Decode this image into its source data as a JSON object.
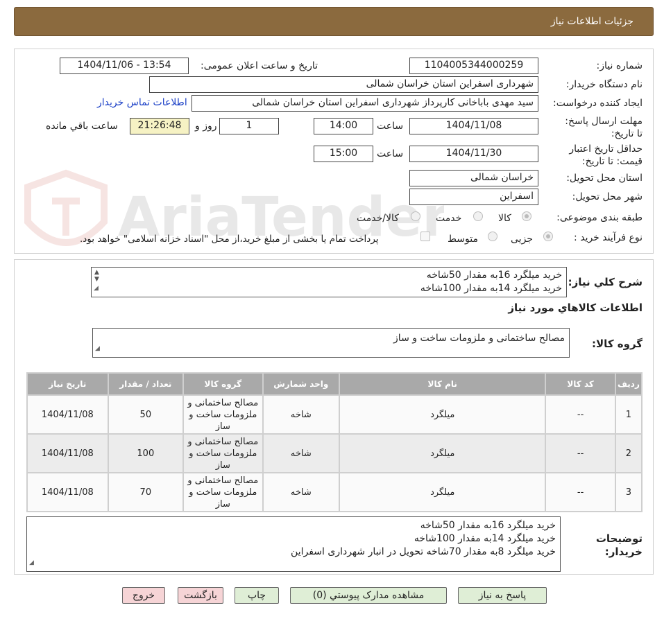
{
  "page_title": "جزئیات اطلاعات نیاز",
  "labels": {
    "need_number": "شماره نیاز:",
    "announce_datetime": "تاریخ و ساعت اعلان عمومی:",
    "buyer_org": "نام دستگاه خریدار:",
    "requester": "ایجاد کننده درخواست:",
    "reply_deadline": "مهلت ارسال پاسخ: تا تاریخ:",
    "hour": "ساعت",
    "day_and": "روز و",
    "remaining": "ساعت باقي مانده",
    "price_validity": "حداقل تاريخ اعتبار قیمت: تا تاریخ:",
    "province": "استان محل تحویل:",
    "city": "شهر محل تحویل:",
    "category": "طبقه بندی موضوعی:",
    "purchase_type": "نوع فرآیند خرید :",
    "general_desc": "شرح کلي نياز:",
    "goods_info": "اطلاعات کالاهاي مورد نياز",
    "goods_group": "گروه کالا:",
    "buyer_notes": "توضیحات خریدار:"
  },
  "values": {
    "need_number": "1104005344000259",
    "announce_datetime": "1404/11/06 - 13:54",
    "buyer_org": "شهرداری اسفراین استان خراسان شمالی",
    "requester": "سید مهدی  باباخانی کارپرداز   شهرداری اسفراین استان خراسان شمالی",
    "buyer_contact_link": "اطلاعات تماس خریدار",
    "reply_date": "1404/11/08",
    "reply_time": "14:00",
    "days": "1",
    "remaining_time": "21:26:48",
    "validity_date": "1404/11/30",
    "validity_time": "15:00",
    "province": "خراسان شمالی",
    "city": "اسفراین",
    "goods_group": "مصالح ساختمانی و ملزومات ساخت و ساز"
  },
  "category_options": {
    "goods": "کالا",
    "service": "خدمت",
    "goods_service": "کالا/خدمت"
  },
  "purchase_options": {
    "partial": "جزیی",
    "medium": "متوسط",
    "treasury_note": "پرداخت تمام یا بخشی از مبلغ خرید،از محل \"اسناد خزانه اسلامی\" خواهد بود."
  },
  "general_desc_lines": [
    "خرید میلگرد 16به مقدار 50شاخه",
    "خرید میلگرد 14به مقدار 100شاخه"
  ],
  "table": {
    "headers": {
      "row": "ردیف",
      "code": "کد کالا",
      "name": "نام کالا",
      "unit": "واحد شمارش",
      "group": "گروه کالا",
      "qty": "تعداد / مقدار",
      "date": "تاریخ نیاز"
    },
    "rows": [
      {
        "row": "1",
        "code": "--",
        "name": "میلگرد",
        "unit": "شاخه",
        "group": "مصالح ساختمانی و ملزومات ساخت و ساز",
        "qty": "50",
        "date": "1404/11/08"
      },
      {
        "row": "2",
        "code": "--",
        "name": "میلگرد",
        "unit": "شاخه",
        "group": "مصالح ساختمانی و ملزومات ساخت و ساز",
        "qty": "100",
        "date": "1404/11/08"
      },
      {
        "row": "3",
        "code": "--",
        "name": "میلگرد",
        "unit": "شاخه",
        "group": "مصالح ساختمانی و ملزومات ساخت و ساز",
        "qty": "70",
        "date": "1404/11/08"
      }
    ]
  },
  "buyer_notes_lines": [
    "خرید میلگرد 16به مقدار 50شاخه",
    "خرید میلگرد 14به مقدار 100شاخه",
    "خرید میلگرد 8به مقدار 70شاخه   تحویل در انبار شهرداری اسفراین"
  ],
  "buttons": {
    "reply": "پاسخ به نیاز",
    "attachments": "مشاهده مدارک پیوستي (0)",
    "print": "چاپ",
    "back": "بازگشت",
    "exit": "خروج"
  },
  "watermark_text": "AriaTender.neT",
  "colors": {
    "title_bar": "#8b6a3e",
    "table_header": "#a9a9a9",
    "link": "#1a3fc6",
    "button_green": "#dfeed6",
    "button_pink": "#f6d4d6",
    "time_box": "#f6f2c4"
  }
}
